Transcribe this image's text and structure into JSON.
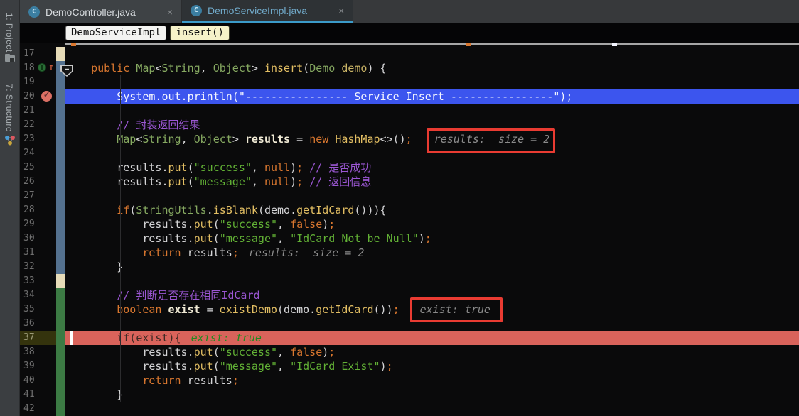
{
  "tabs": [
    {
      "label": "DemoController.java",
      "icon": "class-icon",
      "close": "×",
      "active": false
    },
    {
      "label": "DemoServiceImpl.java",
      "icon": "class-icon",
      "close": "×",
      "active": true
    }
  ],
  "breadcrumbs": {
    "class_chip": "DemoServiceImpl",
    "method_chip": "insert()"
  },
  "toolwindow_bar": {
    "project_label": "1: Project",
    "structure_label": "7: Structure",
    "project_icon": "folder-icon",
    "structure_icon": "structure-icon"
  },
  "colors": {
    "debug_line": "#3C55EE",
    "exec_line": "#D9635B",
    "annotation_box": "#E93B32",
    "vcs_modified": "#54718F",
    "vcs_added": "#3C7B44",
    "vcs_whitespace": "#E6DBB8",
    "tab_underline": "#3C9BC9"
  },
  "editor": {
    "lines": [
      {
        "n": 17,
        "vcs": "beige",
        "tokens": []
      },
      {
        "n": 18,
        "vcs": "blue",
        "gutter": "override",
        "tokens": [
          [
            "pln",
            "    "
          ],
          [
            "kw",
            "public"
          ],
          [
            "pln",
            " "
          ],
          [
            "type",
            "Map"
          ],
          [
            "pln",
            "<"
          ],
          [
            "type",
            "String"
          ],
          [
            "pln",
            ", "
          ],
          [
            "type",
            "Object"
          ],
          [
            "pln",
            "> "
          ],
          [
            "meth",
            "insert"
          ],
          [
            "pln",
            "("
          ],
          [
            "type",
            "Demo"
          ],
          [
            "pln",
            " "
          ],
          [
            "param",
            "demo"
          ],
          [
            "pln",
            ") {"
          ]
        ]
      },
      {
        "n": 19,
        "vcs": "blue",
        "tokens": []
      },
      {
        "n": 20,
        "vcs": "blue",
        "hl": "blue",
        "gutter": "breakpoint",
        "tokens": [
          [
            "white",
            "        System.out.println(\"---------------- Service Insert ----------------\");"
          ]
        ]
      },
      {
        "n": 21,
        "vcs": "blue",
        "tokens": []
      },
      {
        "n": 22,
        "vcs": "blue",
        "tokens": [
          [
            "pln",
            "        "
          ],
          [
            "cmt",
            "// 封装返回结果"
          ]
        ]
      },
      {
        "n": 23,
        "vcs": "blue",
        "tokens": [
          [
            "pln",
            "        "
          ],
          [
            "type",
            "Map"
          ],
          [
            "pln",
            "<"
          ],
          [
            "type",
            "String"
          ],
          [
            "pln",
            ", "
          ],
          [
            "type",
            "Object"
          ],
          [
            "pln",
            "> "
          ],
          [
            "decl",
            "results"
          ],
          [
            "pln",
            " = "
          ],
          [
            "kw",
            "new"
          ],
          [
            "pln",
            " "
          ],
          [
            "meth",
            "HashMap"
          ],
          [
            "pln",
            "<>()"
          ],
          [
            "kw",
            ";"
          ]
        ],
        "hint": {
          "text": "results:  size = 2",
          "cls": "hint-gray",
          "gap": 31
        }
      },
      {
        "n": 24,
        "vcs": "blue",
        "tokens": []
      },
      {
        "n": 25,
        "vcs": "blue",
        "tokens": [
          [
            "pln",
            "        results."
          ],
          [
            "meth",
            "put"
          ],
          [
            "pln",
            "("
          ],
          [
            "str",
            "\"success\""
          ],
          [
            "pln",
            ", "
          ],
          [
            "kw",
            "null"
          ],
          [
            "pln",
            ")"
          ],
          [
            "kw",
            ";"
          ],
          [
            "pln",
            " "
          ],
          [
            "cmt",
            "// 是否成功"
          ]
        ]
      },
      {
        "n": 26,
        "vcs": "blue",
        "tokens": [
          [
            "pln",
            "        results."
          ],
          [
            "meth",
            "put"
          ],
          [
            "pln",
            "("
          ],
          [
            "str",
            "\"message\""
          ],
          [
            "pln",
            ", "
          ],
          [
            "kw",
            "null"
          ],
          [
            "pln",
            ")"
          ],
          [
            "kw",
            ";"
          ],
          [
            "pln",
            " "
          ],
          [
            "cmt",
            "// 返回信息"
          ]
        ]
      },
      {
        "n": 27,
        "vcs": "blue",
        "tokens": []
      },
      {
        "n": 28,
        "vcs": "blue",
        "tokens": [
          [
            "pln",
            "        "
          ],
          [
            "kw",
            "if"
          ],
          [
            "pln",
            "("
          ],
          [
            "type",
            "StringUtils"
          ],
          [
            "pln",
            "."
          ],
          [
            "meth",
            "isBlank"
          ],
          [
            "pln",
            "(demo."
          ],
          [
            "meth",
            "getIdCard"
          ],
          [
            "pln",
            "())){"
          ]
        ]
      },
      {
        "n": 29,
        "vcs": "blue",
        "tokens": [
          [
            "pln",
            "            results."
          ],
          [
            "meth",
            "put"
          ],
          [
            "pln",
            "("
          ],
          [
            "str",
            "\"success\""
          ],
          [
            "pln",
            ", "
          ],
          [
            "kw",
            "false"
          ],
          [
            "pln",
            ")"
          ],
          [
            "kw",
            ";"
          ]
        ]
      },
      {
        "n": 30,
        "vcs": "blue",
        "tokens": [
          [
            "pln",
            "            results."
          ],
          [
            "meth",
            "put"
          ],
          [
            "pln",
            "("
          ],
          [
            "str",
            "\"message\""
          ],
          [
            "pln",
            ", "
          ],
          [
            "str",
            "\"IdCard Not be Null\""
          ],
          [
            "pln",
            ")"
          ],
          [
            "kw",
            ";"
          ]
        ]
      },
      {
        "n": 31,
        "vcs": "blue",
        "tokens": [
          [
            "pln",
            "            "
          ],
          [
            "kw",
            "return"
          ],
          [
            "pln",
            " results"
          ],
          [
            "kw",
            ";"
          ]
        ],
        "hint": {
          "text": "results:  size = 2",
          "cls": "hint-gray",
          "gap": 14
        }
      },
      {
        "n": 32,
        "vcs": "blue",
        "tokens": [
          [
            "pln",
            "        }"
          ]
        ]
      },
      {
        "n": 33,
        "vcs": "beige",
        "tokens": []
      },
      {
        "n": 34,
        "vcs": "green",
        "tokens": [
          [
            "pln",
            "        "
          ],
          [
            "cmt",
            "// 判断是否存在相同IdCard"
          ]
        ]
      },
      {
        "n": 35,
        "vcs": "green",
        "tokens": [
          [
            "pln",
            "        "
          ],
          [
            "kw",
            "boolean"
          ],
          [
            "pln",
            " "
          ],
          [
            "decl",
            "exist"
          ],
          [
            "pln",
            " = "
          ],
          [
            "meth",
            "existDemo"
          ],
          [
            "pln",
            "(demo."
          ],
          [
            "meth",
            "getIdCard"
          ],
          [
            "pln",
            "())"
          ],
          [
            "kw",
            ";"
          ]
        ],
        "hint": {
          "text": "exist: true",
          "cls": "hint-gray",
          "gap": 29
        }
      },
      {
        "n": 36,
        "vcs": "green",
        "tokens": []
      },
      {
        "n": 37,
        "vcs": "green",
        "hl": "red",
        "numOlive": true,
        "caret": true,
        "tokens": [
          [
            "dark",
            "        if(exist){"
          ]
        ],
        "hint": {
          "text": "exist: true",
          "cls": "hint-green",
          "gap": 14
        }
      },
      {
        "n": 38,
        "vcs": "green",
        "tokens": [
          [
            "pln",
            "            results."
          ],
          [
            "meth",
            "put"
          ],
          [
            "pln",
            "("
          ],
          [
            "str",
            "\"success\""
          ],
          [
            "pln",
            ", "
          ],
          [
            "kw",
            "false"
          ],
          [
            "pln",
            ")"
          ],
          [
            "kw",
            ";"
          ]
        ]
      },
      {
        "n": 39,
        "vcs": "green",
        "tokens": [
          [
            "pln",
            "            results."
          ],
          [
            "meth",
            "put"
          ],
          [
            "pln",
            "("
          ],
          [
            "str",
            "\"message\""
          ],
          [
            "pln",
            ", "
          ],
          [
            "str",
            "\"IdCard Exist\""
          ],
          [
            "pln",
            ")"
          ],
          [
            "kw",
            ";"
          ]
        ]
      },
      {
        "n": 40,
        "vcs": "green",
        "tokens": [
          [
            "pln",
            "            "
          ],
          [
            "kw",
            "return"
          ],
          [
            "pln",
            " results"
          ],
          [
            "kw",
            ";"
          ]
        ]
      },
      {
        "n": 41,
        "vcs": "green",
        "tokens": [
          [
            "pln",
            "        }"
          ]
        ]
      },
      {
        "n": 42,
        "vcs": "green",
        "tokens": []
      }
    ]
  }
}
